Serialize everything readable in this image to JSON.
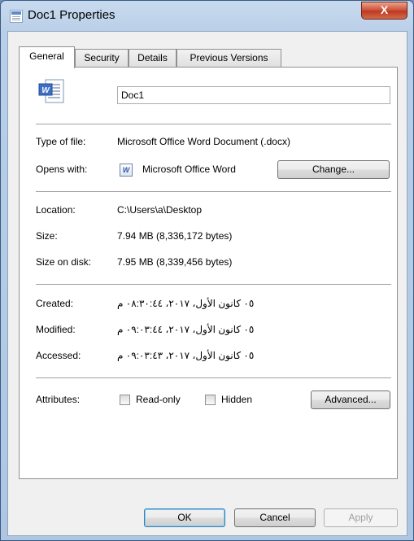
{
  "window": {
    "title": "Doc1 Properties",
    "close_glyph": "X"
  },
  "tabs": [
    "General",
    "Security",
    "Details",
    "Previous Versions"
  ],
  "file": {
    "name": "Doc1"
  },
  "type_of_file": {
    "label": "Type of file:",
    "value": "Microsoft Office Word Document (.docx)"
  },
  "opens_with": {
    "label": "Opens with:",
    "app": "Microsoft Office Word",
    "change_button": "Change..."
  },
  "location": {
    "label": "Location:",
    "value": "C:\\Users\\a\\Desktop"
  },
  "size": {
    "label": "Size:",
    "value": "7.94 MB (8,336,172 bytes)"
  },
  "size_on_disk": {
    "label": "Size on disk:",
    "value": "7.95 MB (8,339,456 bytes)"
  },
  "created": {
    "label": "Created:",
    "value": "٠٥ كانون الأول، ٢٠١٧، ٠٨:٣٠:٤٤ م"
  },
  "modified": {
    "label": "Modified:",
    "value": "٠٥ كانون الأول، ٢٠١٧، ٠٩:٠٣:٤٤ م"
  },
  "accessed": {
    "label": "Accessed:",
    "value": "٠٥ كانون الأول، ٢٠١٧، ٠٩:٠٣:٤٣ م"
  },
  "attributes": {
    "label": "Attributes:",
    "read_only": "Read-only",
    "hidden": "Hidden",
    "advanced_button": "Advanced..."
  },
  "buttons": {
    "ok": "OK",
    "cancel": "Cancel",
    "apply": "Apply"
  },
  "icons": {
    "window": "document-icon",
    "file": "word-document-icon",
    "app": "word-app-icon"
  },
  "colors": {
    "close_button": "#c8462c",
    "frame": "#b9cfe8",
    "default_button_border": "#3c7fb1"
  }
}
